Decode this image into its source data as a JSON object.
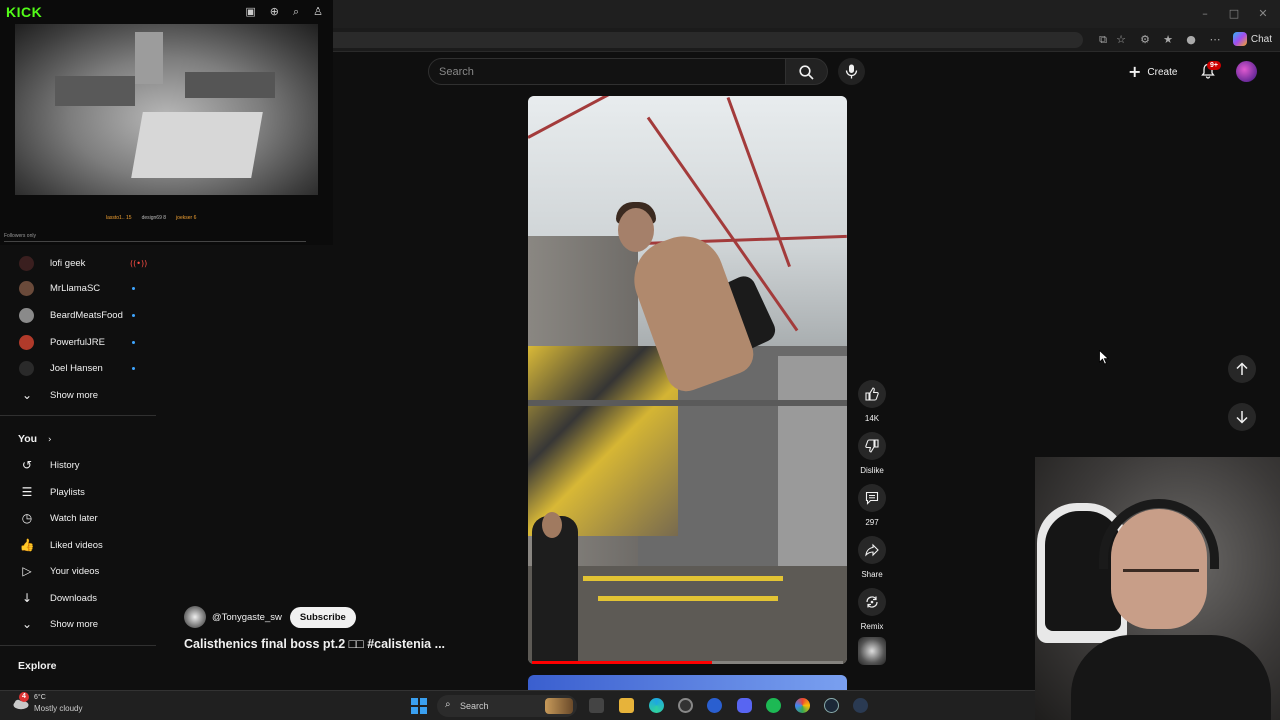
{
  "kick": {
    "logo": "KICK",
    "users": [
      "lassto1..",
      "15",
      "design69",
      "8",
      "joekser",
      "6"
    ],
    "followers_only": "Followers only"
  },
  "browser": {
    "chat_label": "Chat"
  },
  "masthead": {
    "search_placeholder": "Search",
    "create_label": "Create",
    "notification_count": "9+"
  },
  "sidebar": {
    "subscriptions": [
      {
        "name": "lofi geek",
        "live": true,
        "avatar_color": "#3a1f1f"
      },
      {
        "name": "MrLlamaSC",
        "live": false,
        "avatar_color": "#6a4a3a"
      },
      {
        "name": "BeardMeatsFood",
        "live": false,
        "avatar_color": "#8a8a8a"
      },
      {
        "name": "PowerfulJRE",
        "live": false,
        "avatar_color": "#b03a2a"
      },
      {
        "name": "Joel Hansen",
        "live": false,
        "avatar_color": "#2a2a2a"
      }
    ],
    "subs_show_more": "Show more",
    "you_title": "You",
    "you_items": [
      {
        "label": "History",
        "icon": "history-icon"
      },
      {
        "label": "Playlists",
        "icon": "playlists-icon"
      },
      {
        "label": "Watch later",
        "icon": "watch-later-icon"
      },
      {
        "label": "Liked videos",
        "icon": "liked-icon"
      },
      {
        "label": "Your videos",
        "icon": "your-videos-icon"
      },
      {
        "label": "Downloads",
        "icon": "download-icon"
      }
    ],
    "you_show_more": "Show more",
    "explore_title": "Explore"
  },
  "short": {
    "channel": "@Tonygaste_sw",
    "subscribe_label": "Subscribe",
    "title": "Calisthenics final boss pt.2 □□  #calistenia ...",
    "progress": 0.58
  },
  "actions": {
    "like_count": "14K",
    "dislike_label": "Dislike",
    "comment_count": "297",
    "share_label": "Share",
    "remix_label": "Remix"
  },
  "taskbar": {
    "weather_temp": "6°C",
    "weather_condition": "Mostly cloudy",
    "weather_badge": "4",
    "search_label": "Search"
  },
  "colors": {
    "accent_red": "#ff0000",
    "kick_green": "#53fc18",
    "background": "#0f0f0f"
  }
}
